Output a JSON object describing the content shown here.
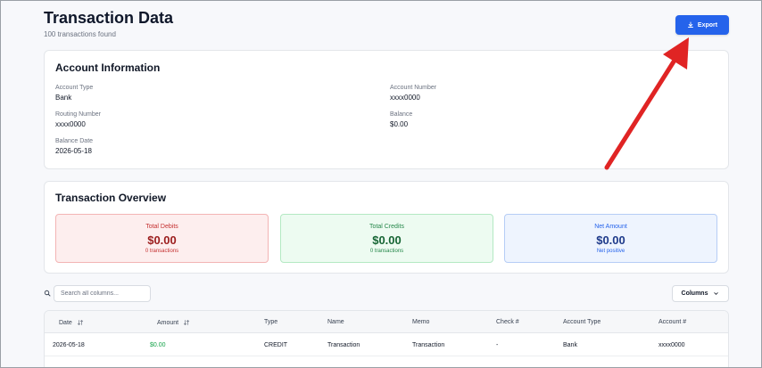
{
  "header": {
    "title": "Transaction Data",
    "subtitle": "100 transactions found",
    "export_label": "Export"
  },
  "account": {
    "title": "Account Information",
    "fields": [
      {
        "label": "Account Type",
        "value": "Bank"
      },
      {
        "label": "Account Number",
        "value": "xxxx0000"
      },
      {
        "label": "Routing Number",
        "value": "xxxx0000"
      },
      {
        "label": "Balance",
        "value": "$0.00"
      },
      {
        "label": "Balance Date",
        "value": "2026-05-18"
      }
    ]
  },
  "overview": {
    "title": "Transaction Overview",
    "stats": [
      {
        "label": "Total Debits",
        "value": "$0.00",
        "sub": "0 transactions"
      },
      {
        "label": "Total Credits",
        "value": "$0.00",
        "sub": "0 transactions"
      },
      {
        "label": "Net Amount",
        "value": "$0.00",
        "sub": "Net positive"
      }
    ]
  },
  "toolbar": {
    "search_placeholder": "Search all columns...",
    "columns_label": "Columns"
  },
  "table": {
    "columns": [
      "Date",
      "Amount",
      "Type",
      "Name",
      "Memo",
      "Check #",
      "Account Type",
      "Account #"
    ],
    "rows": [
      [
        "2026-05-18",
        "$0.00",
        "CREDIT",
        "Transaction",
        "Transaction",
        "-",
        "Bank",
        "xxxx0000"
      ]
    ]
  },
  "colors": {
    "accent": "#2563eb",
    "debit": "#c53030",
    "credit": "#25874a",
    "net": "#2563eb",
    "annotation_arrow": "#e02424"
  },
  "icons": [
    "download-icon",
    "search-icon",
    "sort-icon",
    "chevron-down-icon",
    "annotation-arrow"
  ]
}
